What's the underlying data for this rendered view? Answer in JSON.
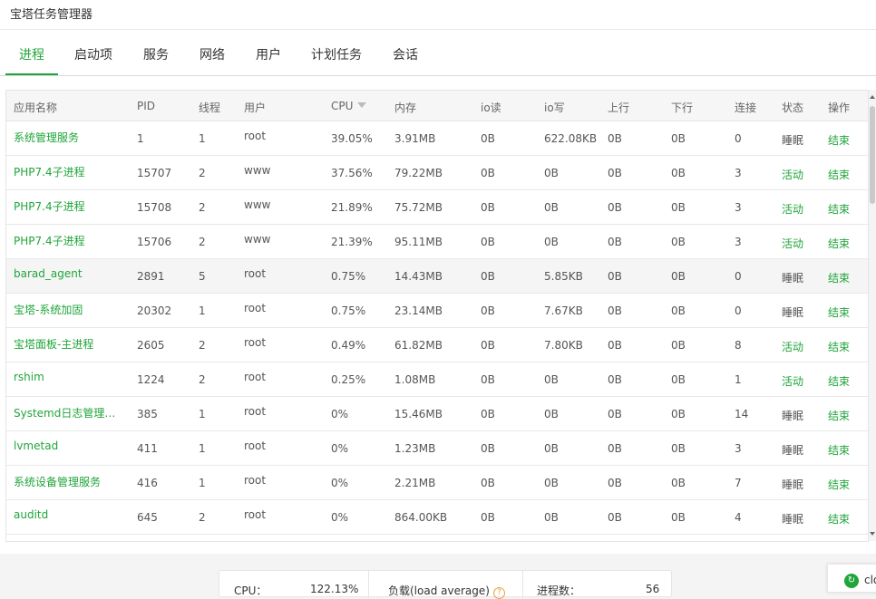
{
  "window": {
    "title": "宝塔任务管理器"
  },
  "tabs": [
    {
      "label": "进程",
      "active": true
    },
    {
      "label": "启动项"
    },
    {
      "label": "服务"
    },
    {
      "label": "网络"
    },
    {
      "label": "用户"
    },
    {
      "label": "计划任务"
    },
    {
      "label": "会话"
    }
  ],
  "table": {
    "headers": {
      "name": "应用名称",
      "pid": "PID",
      "threads": "线程",
      "user": "用户",
      "cpu": "CPU",
      "mem": "内存",
      "io_read": "io读",
      "io_write": "io写",
      "up": "上行",
      "down": "下行",
      "conn": "连接",
      "status": "状态",
      "action": "操作"
    },
    "sort": {
      "column": "cpu",
      "icon": "sort-desc-icon"
    },
    "rows": [
      {
        "name": "系统管理服务",
        "pid": "1",
        "threads": "1",
        "user": "root",
        "cpu": "39.05%",
        "mem": "3.91MB",
        "io_read": "0B",
        "io_write": "622.08KB",
        "up": "0B",
        "down": "0B",
        "conn": "0",
        "status": "睡眠",
        "action": "结束"
      },
      {
        "name": "PHP7.4子进程",
        "pid": "15707",
        "threads": "2",
        "user": "www",
        "cpu": "37.56%",
        "mem": "79.22MB",
        "io_read": "0B",
        "io_write": "0B",
        "up": "0B",
        "down": "0B",
        "conn": "3",
        "status": "活动",
        "action": "结束"
      },
      {
        "name": "PHP7.4子进程",
        "pid": "15708",
        "threads": "2",
        "user": "www",
        "cpu": "21.89%",
        "mem": "75.72MB",
        "io_read": "0B",
        "io_write": "0B",
        "up": "0B",
        "down": "0B",
        "conn": "3",
        "status": "活动",
        "action": "结束"
      },
      {
        "name": "PHP7.4子进程",
        "pid": "15706",
        "threads": "2",
        "user": "www",
        "cpu": "21.39%",
        "mem": "95.11MB",
        "io_read": "0B",
        "io_write": "0B",
        "up": "0B",
        "down": "0B",
        "conn": "3",
        "status": "活动",
        "action": "结束"
      },
      {
        "name": "barad_agent",
        "pid": "2891",
        "threads": "5",
        "user": "root",
        "cpu": "0.75%",
        "mem": "14.43MB",
        "io_read": "0B",
        "io_write": "5.85KB",
        "up": "0B",
        "down": "0B",
        "conn": "0",
        "status": "睡眠",
        "action": "结束",
        "highlighted": true
      },
      {
        "name": "宝塔-系统加固",
        "pid": "20302",
        "threads": "1",
        "user": "root",
        "cpu": "0.75%",
        "mem": "23.14MB",
        "io_read": "0B",
        "io_write": "7.67KB",
        "up": "0B",
        "down": "0B",
        "conn": "0",
        "status": "睡眠",
        "action": "结束"
      },
      {
        "name": "宝塔面板-主进程",
        "pid": "2605",
        "threads": "2",
        "user": "root",
        "cpu": "0.49%",
        "mem": "61.82MB",
        "io_read": "0B",
        "io_write": "7.80KB",
        "up": "0B",
        "down": "0B",
        "conn": "8",
        "status": "活动",
        "action": "结束"
      },
      {
        "name": "rshim",
        "pid": "1224",
        "threads": "2",
        "user": "root",
        "cpu": "0.25%",
        "mem": "1.08MB",
        "io_read": "0B",
        "io_write": "0B",
        "up": "0B",
        "down": "0B",
        "conn": "1",
        "status": "活动",
        "action": "结束"
      },
      {
        "name": "Systemd日志管理服务",
        "pid": "385",
        "threads": "1",
        "user": "root",
        "cpu": "0%",
        "mem": "15.46MB",
        "io_read": "0B",
        "io_write": "0B",
        "up": "0B",
        "down": "0B",
        "conn": "14",
        "status": "睡眠",
        "action": "结束"
      },
      {
        "name": "lvmetad",
        "pid": "411",
        "threads": "1",
        "user": "root",
        "cpu": "0%",
        "mem": "1.23MB",
        "io_read": "0B",
        "io_write": "0B",
        "up": "0B",
        "down": "0B",
        "conn": "3",
        "status": "睡眠",
        "action": "结束"
      },
      {
        "name": "系统设备管理服务",
        "pid": "416",
        "threads": "1",
        "user": "root",
        "cpu": "0%",
        "mem": "2.21MB",
        "io_read": "0B",
        "io_write": "0B",
        "up": "0B",
        "down": "0B",
        "conn": "7",
        "status": "睡眠",
        "action": "结束"
      },
      {
        "name": "auditd",
        "pid": "645",
        "threads": "2",
        "user": "root",
        "cpu": "0%",
        "mem": "864.00KB",
        "io_read": "0B",
        "io_write": "0B",
        "up": "0B",
        "down": "0B",
        "conn": "4",
        "status": "睡眠",
        "action": "结束"
      }
    ]
  },
  "stats": {
    "cpu_label": "CPU：",
    "cpu_value": "122.13%",
    "load_label": "负载(load average)",
    "load_help": "?",
    "proc_label": "进程数：",
    "proc_value": "56"
  },
  "close_button": {
    "label": "clo",
    "icon": "refresh-icon"
  },
  "colors": {
    "accent": "#20a53a",
    "border": "#e5e5e5",
    "header_bg": "#f6f6f6"
  }
}
